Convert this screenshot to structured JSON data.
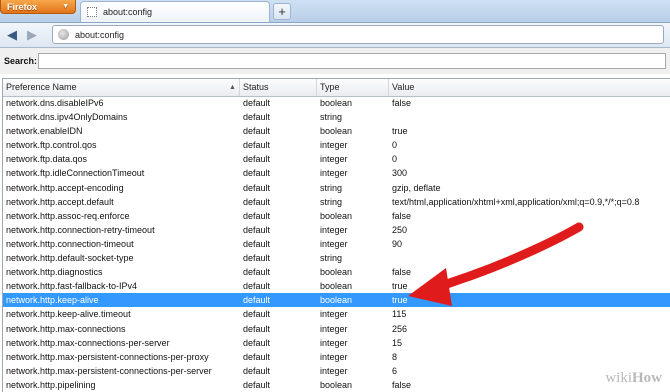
{
  "browser": {
    "menu_button": "Firefox",
    "menu_arrow": "▼",
    "tab_title": "about:config",
    "new_tab": "+",
    "back": "◀",
    "forward": "▶",
    "url": "about:config"
  },
  "search": {
    "label": "Search:",
    "value": ""
  },
  "table": {
    "headers": [
      "Preference Name",
      "Status",
      "Type",
      "Value"
    ],
    "sort_indicator": "▲",
    "rows": [
      {
        "name": "network.dns.disableIPv6",
        "status": "default",
        "type": "boolean",
        "value": "false"
      },
      {
        "name": "network.dns.ipv4OnlyDomains",
        "status": "default",
        "type": "string",
        "value": ""
      },
      {
        "name": "network.enableIDN",
        "status": "default",
        "type": "boolean",
        "value": "true"
      },
      {
        "name": "network.ftp.control.qos",
        "status": "default",
        "type": "integer",
        "value": "0"
      },
      {
        "name": "network.ftp.data.qos",
        "status": "default",
        "type": "integer",
        "value": "0"
      },
      {
        "name": "network.ftp.idleConnectionTimeout",
        "status": "default",
        "type": "integer",
        "value": "300"
      },
      {
        "name": "network.http.accept-encoding",
        "status": "default",
        "type": "string",
        "value": "gzip, deflate"
      },
      {
        "name": "network.http.accept.default",
        "status": "default",
        "type": "string",
        "value": "text/html,application/xhtml+xml,application/xml;q=0.9,*/*;q=0.8"
      },
      {
        "name": "network.http.assoc-req.enforce",
        "status": "default",
        "type": "boolean",
        "value": "false"
      },
      {
        "name": "network.http.connection-retry-timeout",
        "status": "default",
        "type": "integer",
        "value": "250"
      },
      {
        "name": "network.http.connection-timeout",
        "status": "default",
        "type": "integer",
        "value": "90"
      },
      {
        "name": "network.http.default-socket-type",
        "status": "default",
        "type": "string",
        "value": ""
      },
      {
        "name": "network.http.diagnostics",
        "status": "default",
        "type": "boolean",
        "value": "false"
      },
      {
        "name": "network.http.fast-fallback-to-IPv4",
        "status": "default",
        "type": "boolean",
        "value": "true"
      },
      {
        "name": "network.http.keep-alive",
        "status": "default",
        "type": "boolean",
        "value": "true",
        "selected": true
      },
      {
        "name": "network.http.keep-alive.timeout",
        "status": "default",
        "type": "integer",
        "value": "115"
      },
      {
        "name": "network.http.max-connections",
        "status": "default",
        "type": "integer",
        "value": "256"
      },
      {
        "name": "network.http.max-connections-per-server",
        "status": "default",
        "type": "integer",
        "value": "15"
      },
      {
        "name": "network.http.max-persistent-connections-per-proxy",
        "status": "default",
        "type": "integer",
        "value": "8"
      },
      {
        "name": "network.http.max-persistent-connections-per-server",
        "status": "default",
        "type": "integer",
        "value": "6"
      },
      {
        "name": "network.http.pipelining",
        "status": "default",
        "type": "boolean",
        "value": "false"
      }
    ]
  },
  "colors": {
    "selection": "#3399ff",
    "annotation_arrow": "#e01b1b"
  },
  "watermark": {
    "brand": "wiki",
    "brand_bold": "How"
  }
}
